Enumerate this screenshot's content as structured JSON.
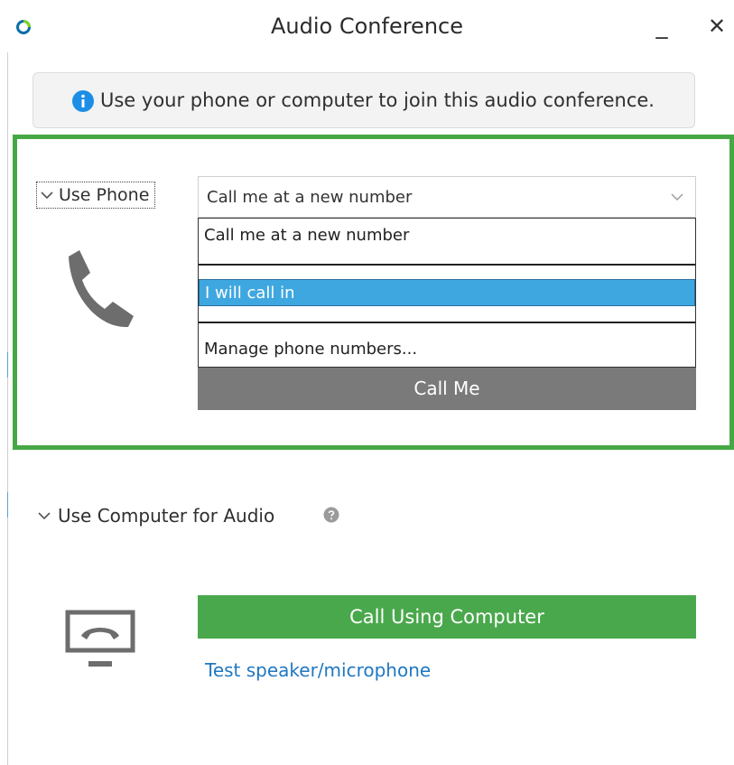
{
  "window": {
    "title": "Audio Conference",
    "minimize_glyph": "_",
    "close_glyph": "✕"
  },
  "banner": {
    "text": "Use your phone or computer to join this audio conference.",
    "icon": "info-icon"
  },
  "phone_section": {
    "toggle_label": "Use Phone",
    "select": {
      "selected": "Call me at a new number",
      "options": [
        "Call me at a new number",
        "I will call in",
        "Manage phone numbers..."
      ],
      "highlighted": "I will call in"
    },
    "call_button": "Call Me"
  },
  "computer_section": {
    "toggle_label": "Use Computer for Audio",
    "call_button": "Call Using Computer",
    "test_link": "Test speaker/microphone"
  },
  "colors": {
    "highlight_frame": "#46a845",
    "selected_option": "#3fa7e0",
    "call_me_button": "#7a7a7a",
    "call_computer_button": "#4aa84c",
    "link": "#1f78c1",
    "info_icon": "#1d8ee6"
  }
}
